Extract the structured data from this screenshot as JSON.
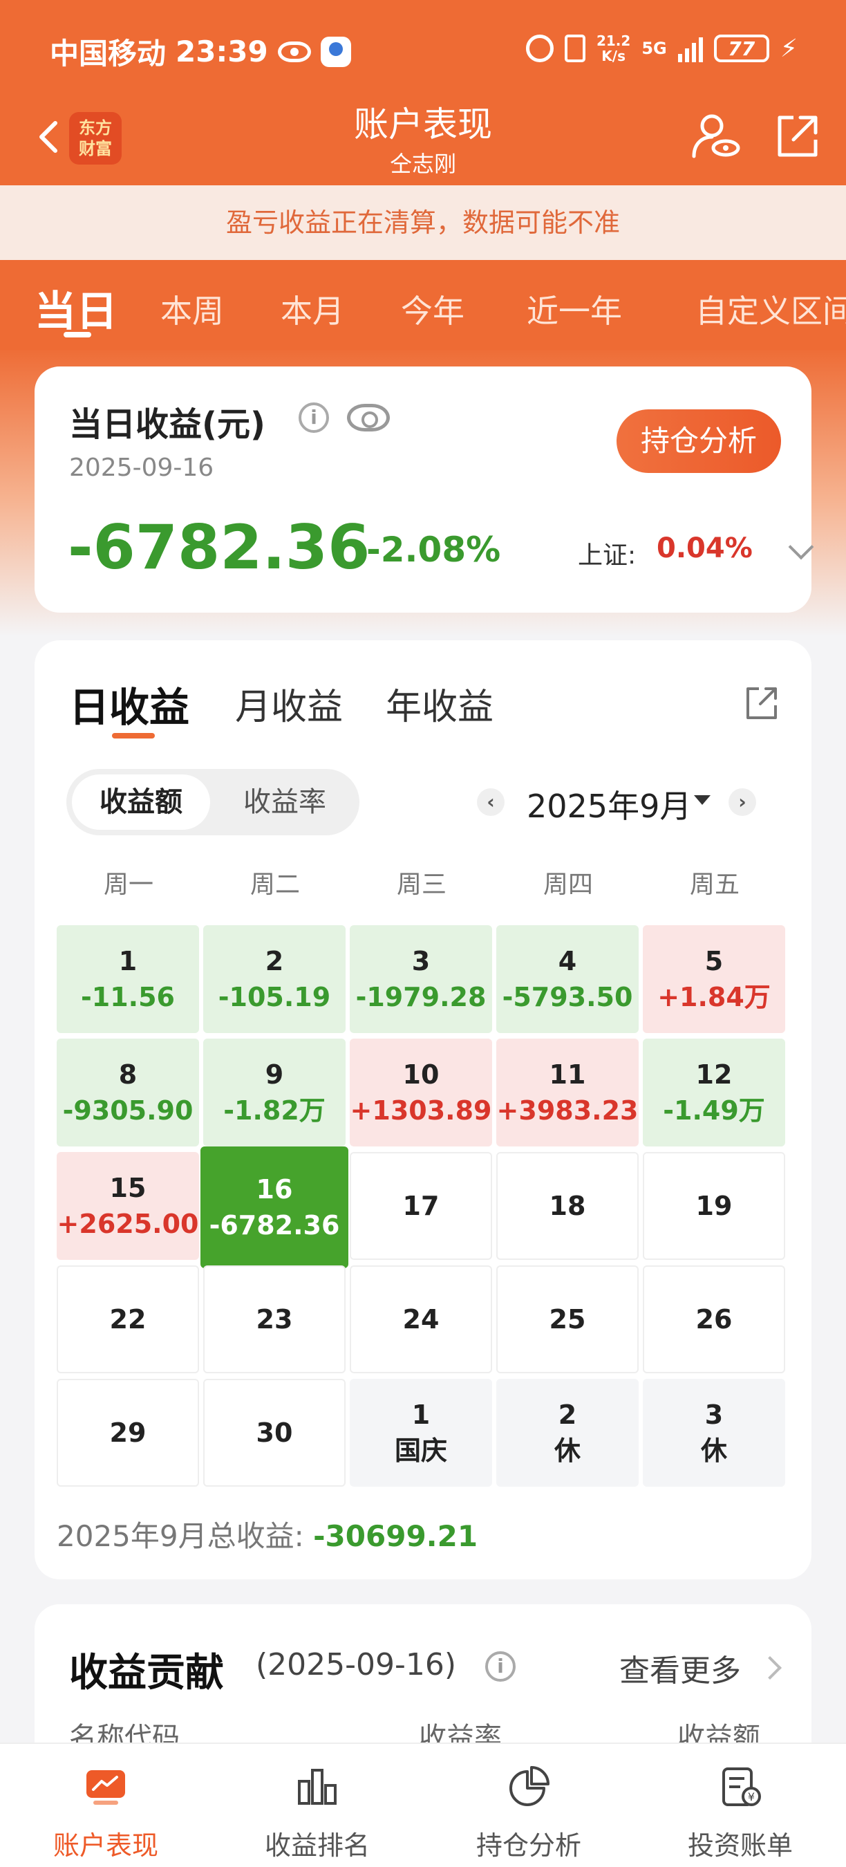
{
  "status_bar": {
    "carrier": "中国移动",
    "time": "23:39",
    "net_speed_top": "21.2",
    "net_speed_bottom": "K/s",
    "net_type": "5G",
    "battery": "77"
  },
  "nav": {
    "back_label": "返回",
    "brand_line1": "东方",
    "brand_line2": "财富",
    "title": "账户表现",
    "subtitle": "仝志刚"
  },
  "notice": "盈亏收益正在清算，数据可能不准",
  "period_tabs": [
    {
      "label": "当日",
      "active": true
    },
    {
      "label": "本周"
    },
    {
      "label": "本月"
    },
    {
      "label": "今年"
    },
    {
      "label": "近一年"
    },
    {
      "label": "自定义区间"
    }
  ],
  "summary": {
    "title": "当日收益(元)",
    "date": "2025-09-16",
    "value": "-6782.36",
    "percent": "-2.08%",
    "index_label": "上证:",
    "index_value": "0.04%",
    "button": "持仓分析"
  },
  "earnings": {
    "tabs": [
      "日收益",
      "月收益",
      "年收益"
    ],
    "segments": [
      "收益额",
      "收益率"
    ],
    "month": "2025年9月",
    "weekdays": [
      "周一",
      "周二",
      "周三",
      "周四",
      "周五"
    ],
    "cells": [
      {
        "d": "1",
        "v": "-11.56",
        "t": "neg"
      },
      {
        "d": "2",
        "v": "-105.19",
        "t": "neg"
      },
      {
        "d": "3",
        "v": "-1979.28",
        "t": "neg"
      },
      {
        "d": "4",
        "v": "-5793.50",
        "t": "neg"
      },
      {
        "d": "5",
        "v": "+1.84万",
        "t": "pos"
      },
      {
        "d": "8",
        "v": "-9305.90",
        "t": "neg"
      },
      {
        "d": "9",
        "v": "-1.82万",
        "t": "neg"
      },
      {
        "d": "10",
        "v": "+1303.89",
        "t": "pos"
      },
      {
        "d": "11",
        "v": "+3983.23",
        "t": "pos"
      },
      {
        "d": "12",
        "v": "-1.49万",
        "t": "neg"
      },
      {
        "d": "15",
        "v": "+2625.00",
        "t": "pos"
      },
      {
        "d": "16",
        "v": "-6782.36",
        "t": "sel"
      },
      {
        "d": "17",
        "v": "",
        "t": "empty"
      },
      {
        "d": "18",
        "v": "",
        "t": "empty"
      },
      {
        "d": "19",
        "v": "",
        "t": "empty"
      },
      {
        "d": "22",
        "v": "",
        "t": "empty"
      },
      {
        "d": "23",
        "v": "",
        "t": "empty"
      },
      {
        "d": "24",
        "v": "",
        "t": "empty"
      },
      {
        "d": "25",
        "v": "",
        "t": "empty"
      },
      {
        "d": "26",
        "v": "",
        "t": "empty"
      },
      {
        "d": "29",
        "v": "",
        "t": "empty"
      },
      {
        "d": "30",
        "v": "",
        "t": "empty"
      },
      {
        "d": "1",
        "v": "国庆",
        "t": "hol"
      },
      {
        "d": "2",
        "v": "休",
        "t": "hol"
      },
      {
        "d": "3",
        "v": "休",
        "t": "hol"
      }
    ],
    "total_label": "2025年9月总收益:",
    "total_value": "-30699.21"
  },
  "contribution": {
    "title": "收益贡献",
    "date": "(2025-09-16)",
    "more": "查看更多",
    "columns": [
      "名称代码",
      "收益率",
      "收益额"
    ]
  },
  "bottom_nav": [
    {
      "label": "账户表现",
      "icon": "account-performance-icon",
      "active": true
    },
    {
      "label": "收益排名",
      "icon": "ranking-icon"
    },
    {
      "label": "持仓分析",
      "icon": "pie-chart-icon"
    },
    {
      "label": "投资账单",
      "icon": "bill-icon"
    }
  ],
  "colors": {
    "brand": "#ee6b34",
    "loss": "#3a9a2e",
    "gain": "#d9362b"
  }
}
